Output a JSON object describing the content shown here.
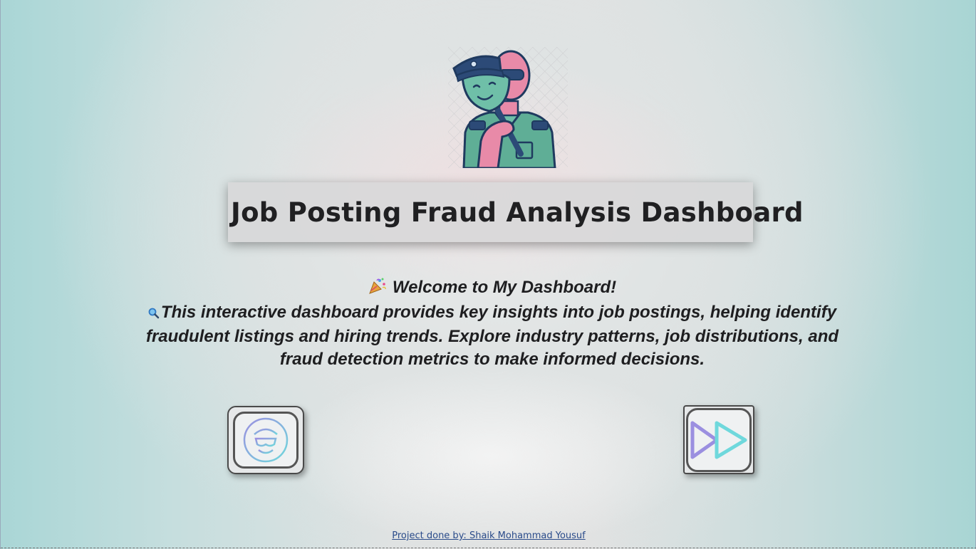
{
  "page": {
    "title": "Job Posting Fraud Analysis Dashboard"
  },
  "welcome": {
    "heading_emoji": "party-popper-icon",
    "heading": "Welcome to My Dashboard!",
    "body_emoji": "magnifier-icon",
    "body": "This interactive dashboard provides key insights into job postings, helping identify fraudulent listings and hiring trends. Explore industry patterns, job distributions, and fraud detection metrics to make informed decisions."
  },
  "buttons": {
    "left_icon": "fraudster-target-icon",
    "right_icon": "fast-forward-icon"
  },
  "footer": {
    "credit": "Project done by: Shaik Mohammad Yousuf"
  },
  "colors": {
    "title_text": "#202022",
    "title_box": "#d7d7d8",
    "link": "#2a4b8a",
    "mask_green": "#6fbfa8",
    "skin_pink": "#e88aa8",
    "navy": "#2c4a77",
    "icon_purple": "#9b8fe0",
    "icon_cyan": "#6fd8dc"
  }
}
